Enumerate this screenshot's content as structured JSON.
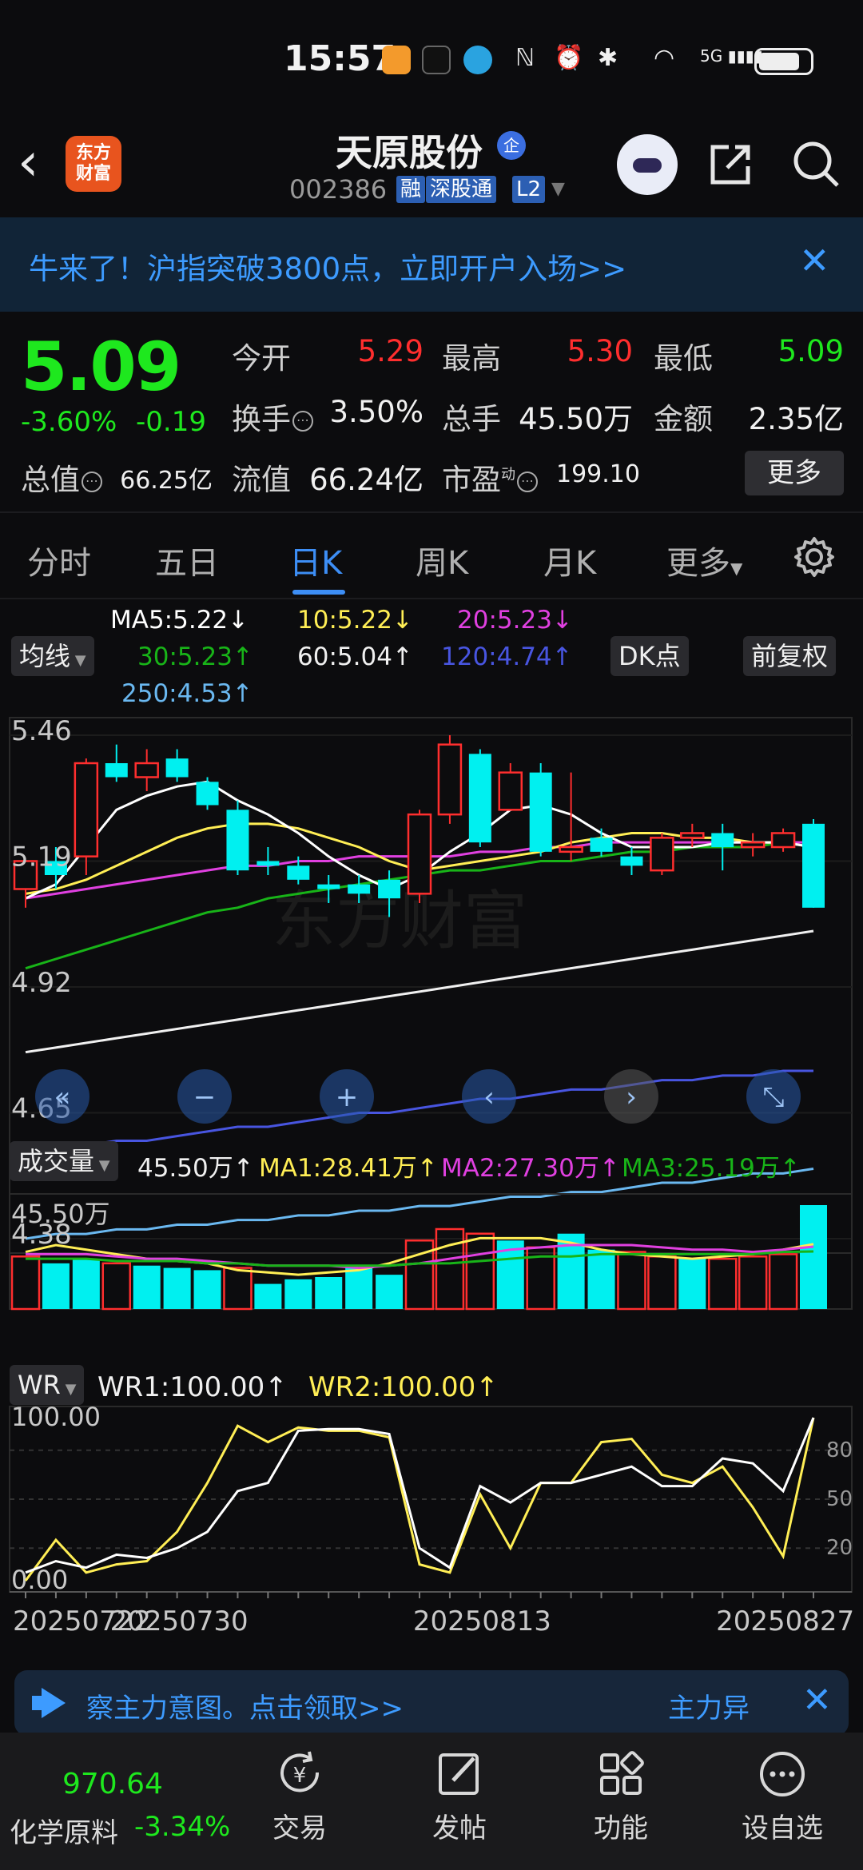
{
  "status_bar": {
    "time": "15:57",
    "network": "5G"
  },
  "header": {
    "logo_text_line1": "东方",
    "logo_text_line2": "财富",
    "stock_name": "天原股份",
    "corp_badge": "企",
    "stock_code": "002386",
    "tags": [
      "融",
      "深股通",
      "L2"
    ]
  },
  "banner": {
    "text": "牛来了！沪指突破3800点，立即开户入场>>",
    "close": "✕"
  },
  "quote": {
    "price": "5.09",
    "change_pct": "-3.60%",
    "change_abs": "-0.19",
    "open_label": "今开",
    "open_value": "5.29",
    "high_label": "最高",
    "high_value": "5.30",
    "low_label": "最低",
    "low_value": "5.09",
    "turnover_label": "换手",
    "turnover_value": "3.50%",
    "volume_label": "总手",
    "volume_value": "45.50万",
    "amount_label": "金额",
    "amount_value": "2.35亿",
    "mktcap_label": "总值",
    "mktcap_value": "66.25亿",
    "float_label": "流值",
    "float_value": "66.24亿",
    "pe_label": "市盈",
    "pe_sup": "动",
    "pe_value": "199.10",
    "more_button": "更多"
  },
  "tabs": {
    "items": [
      "分时",
      "五日",
      "日K",
      "周K",
      "月K",
      "更多"
    ],
    "active": "日K"
  },
  "chart_controls": {
    "ma_selector": "均线",
    "dk_button": "DK点",
    "adjust_button": "前复权",
    "ma5": "MA5:5.22↓",
    "ma10": "10:5.22↓",
    "ma20": "20:5.23↓",
    "ma30": "30:5.23↑",
    "ma60": "60:5.04↑",
    "ma120": "120:4.74↑",
    "ma250": "250:4.53↑",
    "vol_selector": "成交量",
    "vol_value": "45.50万↑",
    "vol_ma1": "MA1:28.41万↑",
    "vol_ma2": "MA2:27.30万↑",
    "vol_ma3": "MA3:25.19万↑",
    "wr_selector": "WR",
    "wr1": "WR1:100.00↑",
    "wr2": "WR2:100.00↑",
    "watermark": "东方财富"
  },
  "colors": {
    "up": "#ff2e2e",
    "down": "#1ee81e",
    "candle_down_fill": "#00f0f0",
    "ma5": "#ffffff",
    "ma10": "#ffee55",
    "ma20": "#e040e0",
    "ma30": "#18b418",
    "ma60": "#f0f0f0",
    "ma120": "#4855e0",
    "ma250": "#6ab8f0",
    "accent": "#3d8ef5"
  },
  "chart_data": [
    {
      "type": "candlestick",
      "title": "日K",
      "y_ticks": [
        "5.46",
        "5.19",
        "4.92",
        "4.65",
        "4.38"
      ],
      "ylim": [
        4.38,
        5.46
      ],
      "x_ticks": [
        "20250722",
        "20250730",
        "20250813",
        "20250827"
      ],
      "candles": [
        {
          "o": 5.13,
          "h": 5.19,
          "l": 5.09,
          "c": 5.19
        },
        {
          "o": 5.19,
          "h": 5.22,
          "l": 5.13,
          "c": 5.16
        },
        {
          "o": 5.2,
          "h": 5.41,
          "l": 5.16,
          "c": 5.4
        },
        {
          "o": 5.4,
          "h": 5.44,
          "l": 5.36,
          "c": 5.37
        },
        {
          "o": 5.37,
          "h": 5.43,
          "l": 5.34,
          "c": 5.4
        },
        {
          "o": 5.41,
          "h": 5.43,
          "l": 5.36,
          "c": 5.37
        },
        {
          "o": 5.36,
          "h": 5.37,
          "l": 5.3,
          "c": 5.31
        },
        {
          "o": 5.3,
          "h": 5.32,
          "l": 5.16,
          "c": 5.17
        },
        {
          "o": 5.19,
          "h": 5.22,
          "l": 5.16,
          "c": 5.18
        },
        {
          "o": 5.18,
          "h": 5.2,
          "l": 5.14,
          "c": 5.15
        },
        {
          "o": 5.14,
          "h": 5.16,
          "l": 5.1,
          "c": 5.13
        },
        {
          "o": 5.14,
          "h": 5.16,
          "l": 5.1,
          "c": 5.12
        },
        {
          "o": 5.15,
          "h": 5.17,
          "l": 5.07,
          "c": 5.11
        },
        {
          "o": 5.12,
          "h": 5.3,
          "l": 5.1,
          "c": 5.29
        },
        {
          "o": 5.29,
          "h": 5.46,
          "l": 5.27,
          "c": 5.44
        },
        {
          "o": 5.42,
          "h": 5.43,
          "l": 5.22,
          "c": 5.23
        },
        {
          "o": 5.3,
          "h": 5.4,
          "l": 5.3,
          "c": 5.38
        },
        {
          "o": 5.38,
          "h": 5.4,
          "l": 5.2,
          "c": 5.21
        },
        {
          "o": 5.21,
          "h": 5.38,
          "l": 5.19,
          "c": 5.22
        },
        {
          "o": 5.24,
          "h": 5.26,
          "l": 5.2,
          "c": 5.21
        },
        {
          "o": 5.2,
          "h": 5.22,
          "l": 5.16,
          "c": 5.18
        },
        {
          "o": 5.17,
          "h": 5.25,
          "l": 5.16,
          "c": 5.24
        },
        {
          "o": 5.24,
          "h": 5.27,
          "l": 5.22,
          "c": 5.25
        },
        {
          "o": 5.25,
          "h": 5.27,
          "l": 5.17,
          "c": 5.22
        },
        {
          "o": 5.22,
          "h": 5.25,
          "l": 5.2,
          "c": 5.23
        },
        {
          "o": 5.22,
          "h": 5.26,
          "l": 5.21,
          "c": 5.25
        },
        {
          "o": 5.27,
          "h": 5.28,
          "l": 5.09,
          "c": 5.09
        }
      ],
      "ma5": [
        5.11,
        5.14,
        5.22,
        5.3,
        5.33,
        5.35,
        5.36,
        5.32,
        5.29,
        5.25,
        5.2,
        5.16,
        5.13,
        5.16,
        5.21,
        5.25,
        5.3,
        5.31,
        5.29,
        5.25,
        5.22,
        5.22,
        5.22,
        5.23,
        5.23,
        5.23,
        5.22
      ],
      "ma10": [
        5.12,
        5.13,
        5.15,
        5.18,
        5.21,
        5.24,
        5.26,
        5.27,
        5.27,
        5.26,
        5.24,
        5.22,
        5.19,
        5.17,
        5.18,
        5.19,
        5.2,
        5.21,
        5.23,
        5.24,
        5.25,
        5.25,
        5.24,
        5.24,
        5.23,
        5.23,
        5.22
      ],
      "ma20": [
        5.11,
        5.12,
        5.13,
        5.14,
        5.15,
        5.16,
        5.17,
        5.18,
        5.18,
        5.19,
        5.19,
        5.2,
        5.2,
        5.2,
        5.2,
        5.21,
        5.21,
        5.22,
        5.22,
        5.23,
        5.23,
        5.23,
        5.23,
        5.23,
        5.23,
        5.23,
        5.23
      ],
      "ma30": [
        4.96,
        4.98,
        5.0,
        5.02,
        5.04,
        5.06,
        5.08,
        5.09,
        5.11,
        5.12,
        5.13,
        5.14,
        5.15,
        5.16,
        5.17,
        5.17,
        5.18,
        5.19,
        5.19,
        5.2,
        5.21,
        5.21,
        5.22,
        5.22,
        5.22,
        5.23,
        5.23
      ],
      "ma60": [
        4.78,
        4.79,
        4.8,
        4.81,
        4.82,
        4.83,
        4.84,
        4.85,
        4.86,
        4.87,
        4.88,
        4.89,
        4.9,
        4.91,
        4.92,
        4.93,
        4.94,
        4.95,
        4.96,
        4.97,
        4.98,
        4.99,
        5.0,
        5.01,
        5.02,
        5.03,
        5.04
      ],
      "ma120": [
        4.56,
        4.57,
        4.58,
        4.59,
        4.59,
        4.6,
        4.61,
        4.62,
        4.62,
        4.63,
        4.64,
        4.65,
        4.65,
        4.66,
        4.67,
        4.68,
        4.68,
        4.69,
        4.7,
        4.7,
        4.71,
        4.72,
        4.72,
        4.73,
        4.73,
        4.74,
        4.74
      ],
      "ma250": [
        4.38,
        4.39,
        4.39,
        4.4,
        4.4,
        4.41,
        4.41,
        4.42,
        4.42,
        4.43,
        4.43,
        4.44,
        4.44,
        4.45,
        4.45,
        4.46,
        4.47,
        4.47,
        4.48,
        4.48,
        4.49,
        4.5,
        4.5,
        4.51,
        4.52,
        4.52,
        4.53
      ]
    },
    {
      "type": "bar",
      "title": "成交量",
      "y_ticks": [
        "45.50万"
      ],
      "ylim": [
        0,
        45.5
      ],
      "values": [
        23,
        20,
        22,
        20,
        19,
        18,
        17,
        18,
        11,
        13,
        14,
        18,
        15,
        30,
        35,
        33,
        30,
        27,
        33,
        26,
        25,
        23,
        22,
        22,
        23,
        24,
        45.5
      ],
      "up": [
        true,
        false,
        false,
        true,
        false,
        false,
        false,
        true,
        false,
        false,
        false,
        false,
        false,
        true,
        true,
        true,
        false,
        true,
        false,
        false,
        true,
        true,
        false,
        true,
        true,
        true,
        false
      ],
      "ma1": [
        25,
        28,
        26,
        24,
        22,
        21,
        20,
        17,
        16,
        15,
        16,
        17,
        20,
        24,
        28,
        31,
        31,
        31,
        29,
        26,
        24,
        23,
        22,
        23,
        24,
        26,
        28.41
      ],
      "ma2": [
        24,
        24,
        24,
        23,
        22,
        22,
        21,
        20,
        19,
        19,
        19,
        18,
        19,
        20,
        22,
        24,
        26,
        27,
        28,
        28,
        28,
        27,
        26,
        26,
        25,
        26,
        27.3
      ],
      "ma3": [
        22,
        22,
        22,
        21,
        21,
        21,
        20,
        20,
        19,
        19,
        19,
        19,
        19,
        20,
        20,
        21,
        22,
        23,
        23,
        24,
        24,
        24,
        24,
        24,
        24,
        25,
        25.19
      ]
    },
    {
      "type": "line",
      "title": "WR",
      "y_ticks": [
        "100.00",
        "0.00"
      ],
      "right_ticks": [
        "80",
        "50",
        "20"
      ],
      "ylim": [
        0,
        100
      ],
      "series": [
        {
          "name": "WR1",
          "values": [
            5,
            12,
            8,
            16,
            14,
            20,
            30,
            55,
            60,
            92,
            93,
            93,
            90,
            20,
            8,
            58,
            48,
            60,
            60,
            65,
            70,
            58,
            58,
            75,
            72,
            55,
            100
          ]
        },
        {
          "name": "WR2",
          "values": [
            0,
            25,
            5,
            10,
            12,
            30,
            60,
            95,
            85,
            94,
            92,
            92,
            88,
            10,
            5,
            53,
            20,
            60,
            60,
            85,
            87,
            65,
            60,
            70,
            45,
            15,
            100
          ]
        }
      ]
    }
  ],
  "notice": {
    "text": "察主力意图。点击领取>>",
    "right_text": "主力异",
    "close": "✕"
  },
  "bottom_nav": {
    "index_value": "970.64",
    "index_name": "化学原料",
    "index_pct": "-3.34%",
    "items": [
      "交易",
      "发帖",
      "功能",
      "设自选"
    ]
  }
}
